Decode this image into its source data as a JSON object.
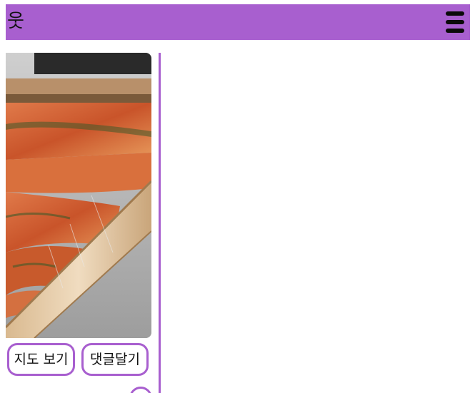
{
  "header": {
    "logo_glyph": "웃",
    "menu_icon": "hamburger-menu-icon",
    "background_color": "#a85fcf"
  },
  "post": {
    "image_description_icon": "food-photo",
    "buttons": {
      "map": "지도 보기",
      "comment": "댓글달기"
    },
    "like_icon": "heart-icon",
    "like_glyph": "♥"
  },
  "colors": {
    "accent": "#a85fcf",
    "background": "#ffffff"
  }
}
